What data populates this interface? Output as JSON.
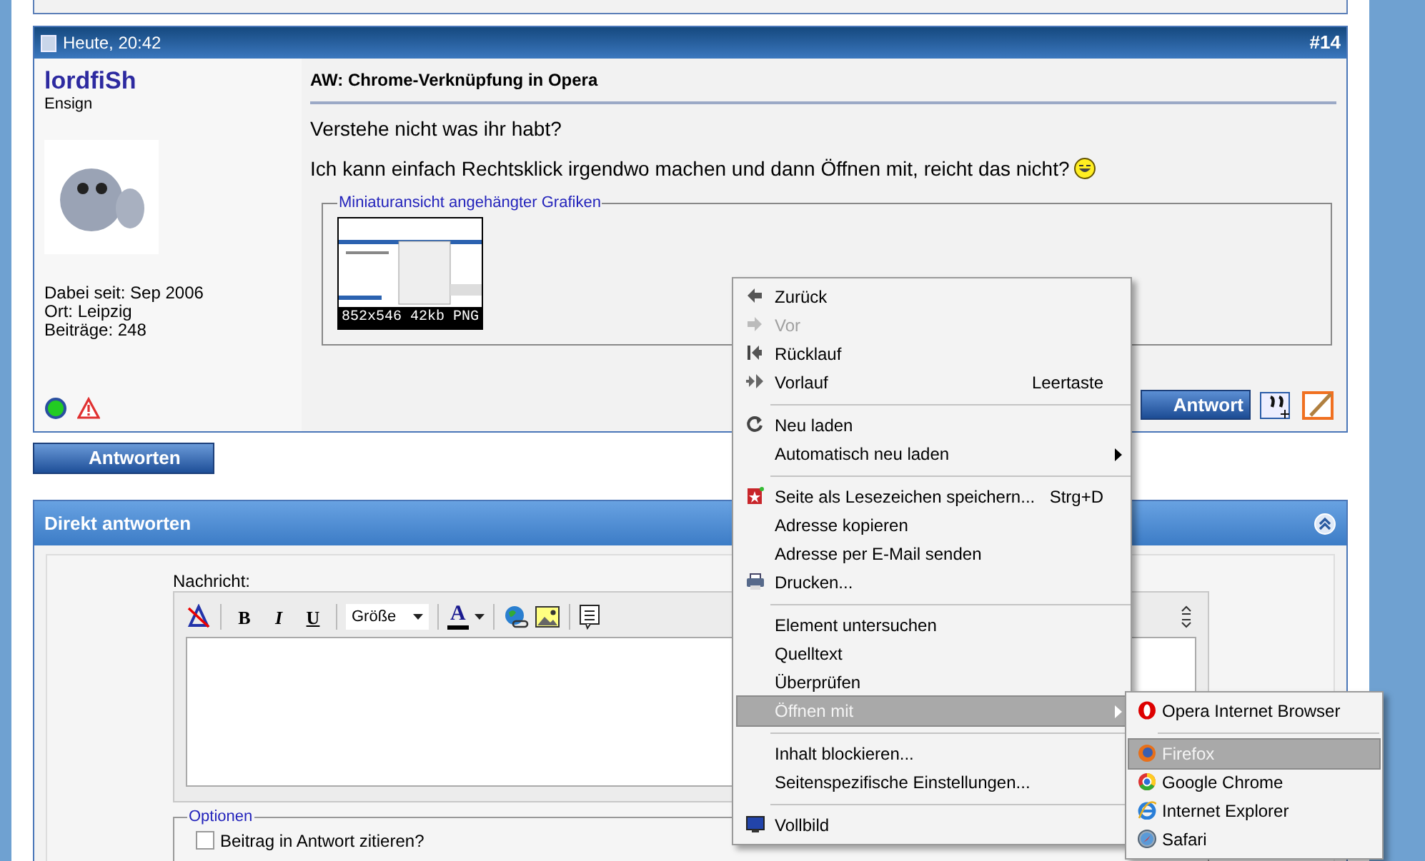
{
  "post": {
    "date": "Heute, 20:42",
    "number": "#14",
    "author": {
      "name": "lordfiSh",
      "rank": "Ensign",
      "stats": [
        "Dabei seit: Sep 2006",
        "Ort: Leipzig",
        "Beiträge: 248"
      ],
      "online": true
    },
    "title": "AW: Chrome-Verknüpfung in Opera",
    "paragraphs": [
      "Verstehe nicht was ihr habt?",
      "Ich kann einfach Rechtsklick irgendwo machen und dann Öffnen mit, reicht das nicht?"
    ],
    "attachments": {
      "legend": "Miniaturansicht angehängter Grafiken",
      "thumbnails": [
        {
          "caption": "852x546 42kb PNG"
        }
      ]
    },
    "reply_button": "Antwort"
  },
  "reply_button": "Antworten",
  "quick_reply": {
    "title": "Direkt antworten",
    "message_label": "Nachricht:",
    "format_buttons": [
      "B",
      "I",
      "U"
    ],
    "size_select": "Größe",
    "font_color": "A",
    "options_legend": "Optionen",
    "options": [
      {
        "label": "Beitrag in Antwort zitieren?",
        "checked": false
      }
    ]
  },
  "context_menu": {
    "items": [
      {
        "kind": "item",
        "label": "Zurück",
        "disabled": false,
        "selected": false,
        "has_submenu": false
      },
      {
        "kind": "item",
        "label": "Vor",
        "disabled": true,
        "selected": false,
        "has_submenu": false
      },
      {
        "kind": "item",
        "label": "Rücklauf",
        "disabled": false,
        "selected": false,
        "has_submenu": false
      },
      {
        "kind": "item",
        "label": "Vorlauf",
        "shortcut": "Leertaste",
        "disabled": false,
        "selected": false,
        "has_submenu": false
      },
      {
        "kind": "separator"
      },
      {
        "kind": "item",
        "label": "Neu laden",
        "disabled": false,
        "selected": false,
        "has_submenu": false
      },
      {
        "kind": "item",
        "label": "Automatisch neu laden",
        "disabled": false,
        "selected": false,
        "has_submenu": true
      },
      {
        "kind": "separator"
      },
      {
        "kind": "item",
        "label": "Seite als Lesezeichen speichern...",
        "shortcut": "Strg+D",
        "disabled": false,
        "selected": false,
        "has_submenu": false
      },
      {
        "kind": "item",
        "label": "Adresse kopieren",
        "disabled": false,
        "selected": false,
        "has_submenu": false
      },
      {
        "kind": "item",
        "label": "Adresse per E-Mail senden",
        "disabled": false,
        "selected": false,
        "has_submenu": false
      },
      {
        "kind": "item",
        "label": "Drucken...",
        "disabled": false,
        "selected": false,
        "has_submenu": false
      },
      {
        "kind": "separator"
      },
      {
        "kind": "item",
        "label": "Element untersuchen",
        "disabled": false,
        "selected": false,
        "has_submenu": false
      },
      {
        "kind": "item",
        "label": "Quelltext",
        "disabled": false,
        "selected": false,
        "has_submenu": false
      },
      {
        "kind": "item",
        "label": "Überprüfen",
        "disabled": false,
        "selected": false,
        "has_submenu": false
      },
      {
        "kind": "item",
        "label": "Öffnen mit",
        "disabled": false,
        "selected": true,
        "has_submenu": true
      },
      {
        "kind": "separator"
      },
      {
        "kind": "item",
        "label": "Inhalt blockieren...",
        "disabled": false,
        "selected": false,
        "has_submenu": false
      },
      {
        "kind": "item",
        "label": "Seitenspezifische Einstellungen...",
        "disabled": false,
        "selected": false,
        "has_submenu": false
      },
      {
        "kind": "separator"
      },
      {
        "kind": "item",
        "label": "Vollbild",
        "disabled": false,
        "selected": false,
        "has_submenu": false
      }
    ]
  },
  "submenu": {
    "items": [
      {
        "kind": "item",
        "label": "Opera Internet Browser",
        "selected": false
      },
      {
        "kind": "separator"
      },
      {
        "kind": "item",
        "label": "Firefox",
        "selected": true
      },
      {
        "kind": "item",
        "label": "Google Chrome",
        "selected": false
      },
      {
        "kind": "item",
        "label": "Internet Explorer",
        "selected": false
      },
      {
        "kind": "item",
        "label": "Safari",
        "selected": false
      }
    ]
  }
}
